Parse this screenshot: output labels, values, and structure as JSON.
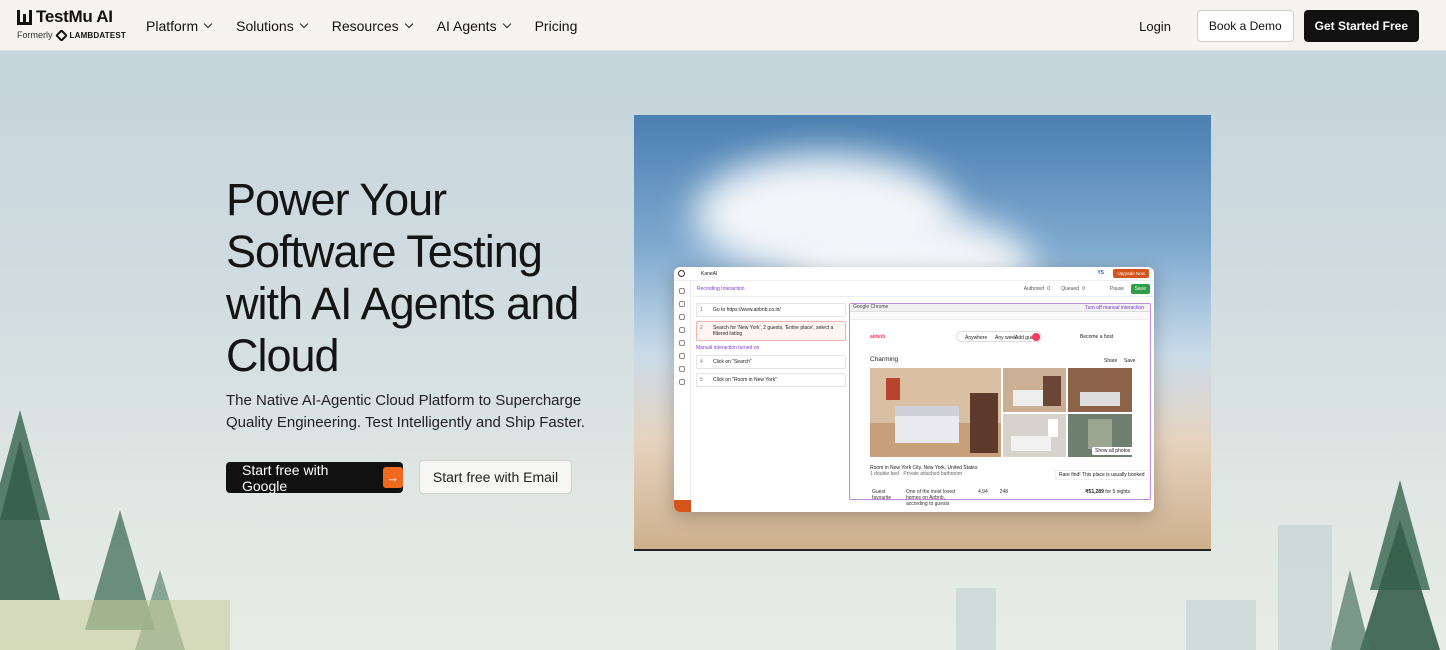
{
  "brand": {
    "name": "TestMu AI",
    "formerly_label": "Formerly",
    "former_name": "LAMBDATEST"
  },
  "nav": {
    "items": [
      {
        "label": "Platform",
        "has_dropdown": true
      },
      {
        "label": "Solutions",
        "has_dropdown": true
      },
      {
        "label": "Resources",
        "has_dropdown": true
      },
      {
        "label": "AI Agents",
        "has_dropdown": true
      },
      {
        "label": "Pricing",
        "has_dropdown": false
      }
    ],
    "login": "Login",
    "book_demo": "Book a Demo",
    "get_started": "Get Started Free"
  },
  "hero": {
    "title": "Power Your Software Testing with AI Agents and Cloud",
    "subtitle": "The Native AI-Agentic Cloud Platform to Supercharge Quality Engineering. Test Intelligently and Ship Faster.",
    "cta_google": "Start free with Google",
    "cta_email": "Start free with Email"
  },
  "preview": {
    "app_name": "KaneAI",
    "upgrade": "Upgrade Now",
    "user_initials": "YS",
    "recording": "Recording Interaction",
    "authored": "Authored",
    "authored_count": "0",
    "queued": "Queued",
    "queued_count": "0",
    "pause": "Pause",
    "save": "Save",
    "steps": [
      {
        "n": "1",
        "text": "Go to https://www.airbnb.co.in/"
      },
      {
        "n": "2",
        "text": "Search for 'New York', 2 guests, 'Entire place', select a filtered listing"
      },
      {
        "n": "4",
        "text": "Click on \"Search\""
      },
      {
        "n": "5",
        "text": "Click on \"Room in New York\""
      }
    ],
    "manual_label": "Manual interaction turned on",
    "browser_title": "Google Chrome",
    "turn_off": "Turn off manual interaction",
    "site_logo": "airbnb",
    "search_pill": [
      "Anywhere",
      "Any week",
      "Add guests"
    ],
    "host_label": "Become a host",
    "page_heading": "Charming",
    "share_label": "Share",
    "save_label": "Save",
    "show_all": "Show all photos",
    "listing_title": "Room in New York City, New York, United States",
    "listing_sub": "1 double bed · Private attached bathroom",
    "rare_find": "Rare find! This place is usually booked",
    "guest_fav": "Guest favourite",
    "guest_fav_desc": "One of the most loved homes on Airbnb, according to guests",
    "rating": "4.94",
    "reviews": "248",
    "price": "₹51,289",
    "price_suffix": "for 5 nights"
  }
}
